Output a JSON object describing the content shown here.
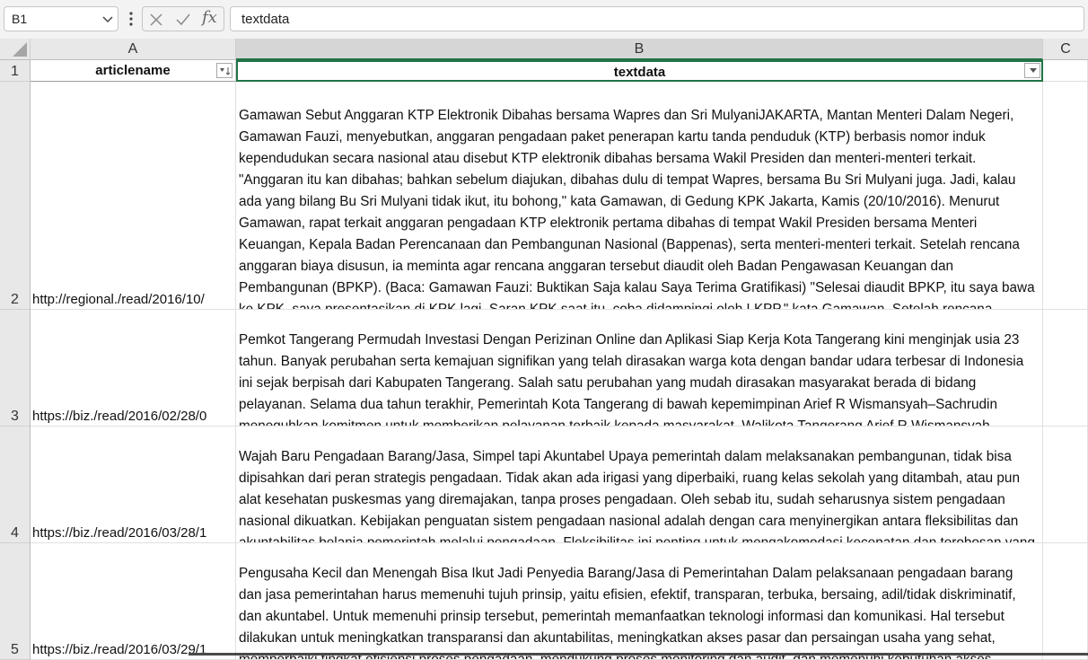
{
  "formula_bar": {
    "name_box": "B1",
    "formula": "textdata"
  },
  "columns": [
    "A",
    "B",
    "C"
  ],
  "header_row": {
    "row_number": "1",
    "A": "articlename",
    "B": "textdata"
  },
  "rows": [
    {
      "row_number": "2",
      "url": "http://regional./read/2016/10/",
      "text": "Gamawan Sebut Anggaran KTP Elektronik Dibahas bersama Wapres dan Sri MulyaniJAKARTA,   Mantan Menteri Dalam Negeri, Gamawan Fauzi, menyebutkan, anggaran pengadaan paket penerapan kartu tanda penduduk (KTP) berbasis nomor induk kependudukan secara nasional atau disebut KTP elektronik dibahas bersama Wakil Presiden dan menteri-menteri terkait. \"Anggaran itu kan dibahas; bahkan sebelum diajukan, dibahas dulu di tempat Wapres, bersama Bu Sri Mulyani juga. Jadi, kalau ada yang bilang Bu Sri Mulyani tidak ikut, itu bohong,\" kata Gamawan, di Gedung KPK Jakarta, Kamis (20/10/2016). Menurut Gamawan, rapat terkait anggaran pengadaan KTP elektronik pertama dibahas di tempat Wakil Presiden bersama Menteri Keuangan, Kepala Badan Perencanaan dan Pembangunan Nasional (Bappenas), serta menteri-menteri terkait. Setelah rencana anggaran biaya disusun, ia meminta agar rencana anggaran tersebut diaudit oleh Badan Pengawasan Keuangan dan Pembangunan (BPKP). (Baca: Gamawan Fauzi: Buktikan Saja kalau Saya Terima Gratifikasi) \"Selesai diaudit BPKP, itu saya bawa ke KPK, saya presentasikan di KPK lagi. Saran KPK saat itu, coba didampingi oleh LKPP,\" kata Gamawan. Setelah rencana anggaran diawasi oleh auditor, menurut dia, proses tender baru bisa dilakukan. Proses"
    },
    {
      "row_number": "3",
      "url": "https://biz./read/2016/02/28/0",
      "text": "Pemkot Tangerang Permudah Investasi Dengan Perizinan Online dan Aplikasi Siap Kerja Kota Tangerang kini menginjak usia 23 tahun. Banyak perubahan serta kemajuan signifikan yang telah dirasakan warga kota dengan bandar udara terbesar di Indonesia  ini sejak berpisah dari Kabupaten Tangerang. Salah satu perubahan yang mudah dirasakan masyarakat berada di bidang pelayanan. Selama dua tahun terakhir, Pemerintah Kota Tangerang di bawah kepemimpinan Arief R Wismansyah–Sachrudin meneguhkan komitmen untuk memberikan pelayanan terbaik kepada masyarakat. Walikota Tangerang Arief R Wismansyah mengungkapkan Pemerintah Kota Tangerang terus berusaha meningkatkan pelayanan"
    },
    {
      "row_number": "4",
      "url": "https://biz./read/2016/03/28/1",
      "text": "Wajah Baru Pengadaan Barang/Jasa, Simpel tapi Akuntabel Upaya pemerintah dalam melaksanakan pembangunan, tidak bisa dipisahkan dari peran strategis pengadaan. Tidak akan ada irigasi yang diperbaiki, ruang kelas sekolah yang ditambah, atau pun alat kesehatan puskesmas yang diremajakan, tanpa proses pengadaan.   Oleh sebab itu, sudah seharusnya sistem pengadaan nasional dikuatkan. Kebijakan penguatan sistem pengadaan nasional adalah dengan cara menyinergikan antara fleksibilitas dan akuntabilitas belanja pemerintah melalui pengadaan.  Fleksibilitas ini penting untuk  mengakomodasi kecepatan dan terobosan yang dibutuhkan dalam pengadaan barang/jasa, tetapi tanpa meninggalkan prinsip tranparansi"
    },
    {
      "row_number": "5",
      "url": "https://biz./read/2016/03/29/1",
      "text": "Pengusaha Kecil dan Menengah Bisa Ikut Jadi Penyedia Barang/Jasa di Pemerintahan Dalam pelaksanaan pengadaan barang dan jasa pemerintahan harus memenuhi tujuh prinsip, yaitu efisien, efektif, transparan, terbuka, bersaing, adil/tidak diskriminatif, dan akuntabel. Untuk memenuhi prinsip tersebut, pemerintah memanfaatkan teknologi informasi dan komunikasi. Hal tersebut dilakukan untuk meningkatkan transparansi dan akuntabilitas, meningkatkan akses pasar dan persaingan usaha yang sehat, memperbaiki tingkat efisiensi proses pengadaan, mendukung proses monitoring dan audit, dan memenuhi kebutuhan akses informasi yang real time. Seperti yang sudah diketahui bersama bahwa setiap tahunnya"
    }
  ]
}
